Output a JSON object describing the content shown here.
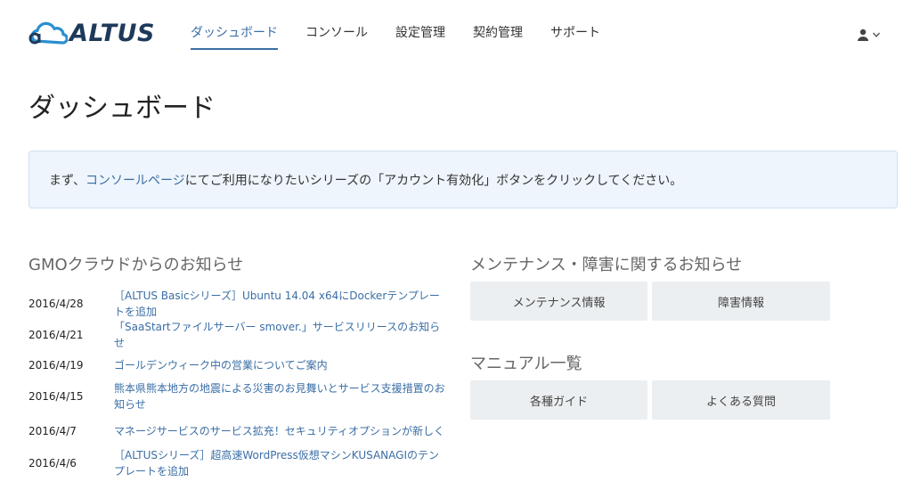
{
  "header": {
    "logo_text": "ALTUS",
    "nav": [
      {
        "label": "ダッシュボード",
        "active": true
      },
      {
        "label": "コンソール"
      },
      {
        "label": "設定管理"
      },
      {
        "label": "契約管理"
      },
      {
        "label": "サポート"
      }
    ],
    "user_icon": "user-icon",
    "user_chevron": "chevron-down-icon"
  },
  "page": {
    "title": "ダッシュボード"
  },
  "notice": {
    "prefix": "まず、",
    "link": "コンソールページ",
    "suffix": "にてご利用になりたいシリーズの「アカウント有効化」ボタンをクリックしてください。"
  },
  "news": {
    "title": "GMOクラウドからのお知らせ",
    "items": [
      {
        "date": "2016/4/28",
        "text": "［ALTUS Basicシリーズ］Ubuntu 14.04 x64にDockerテンプレートを追加"
      },
      {
        "date": "2016/4/21",
        "text": "「SaaStartファイルサーバー smover.」サービスリリースのお知らせ"
      },
      {
        "date": "2016/4/19",
        "text": "ゴールデンウィーク中の営業についてご案内"
      },
      {
        "date": "2016/4/15",
        "text": "熊本県熊本地方の地震による災害のお見舞いとサービス支援措置のお知らせ"
      },
      {
        "date": "2016/4/7",
        "text": "マネージサービスのサービス拡充！セキュリティオプションが新しく"
      },
      {
        "date": "2016/4/6",
        "text": "［ALTUSシリーズ］超高速WordPress仮想マシンKUSANAGIのテンプレートを追加"
      }
    ]
  },
  "maintenance": {
    "title": "メンテナンス・障害に関するお知らせ",
    "buttons": [
      "メンテナンス情報",
      "障害情報"
    ]
  },
  "manual": {
    "title": "マニュアル一覧",
    "buttons": [
      "各種ガイド",
      "よくある質問"
    ]
  },
  "colors": {
    "accent": "#3a6ea5",
    "logo": "#1e3a5a",
    "notice_bg": "#eef5fc",
    "button_bg": "#eceff1"
  }
}
